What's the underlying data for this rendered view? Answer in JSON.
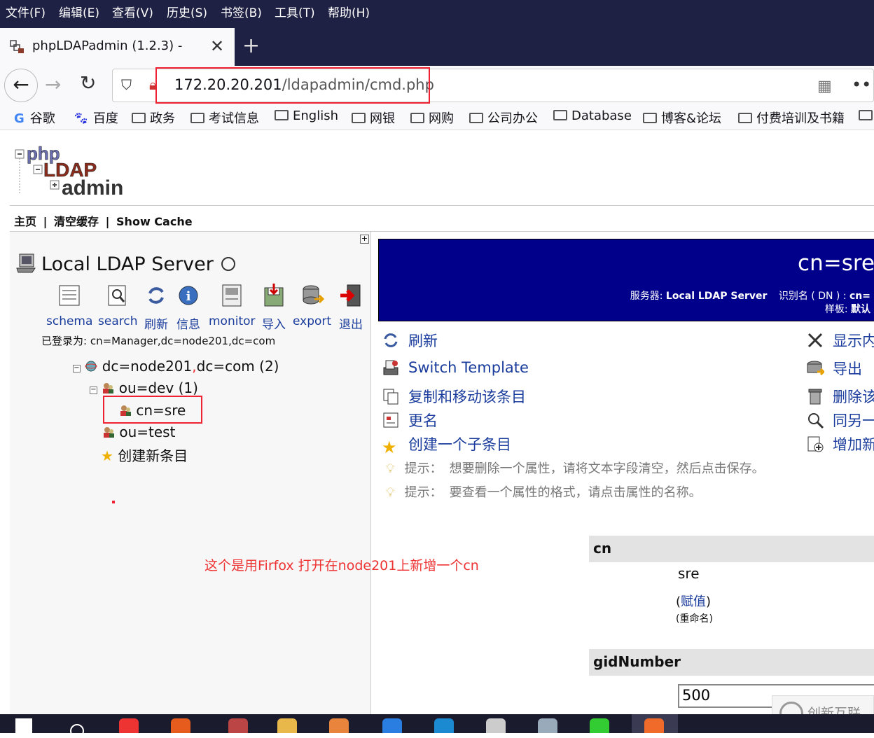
{
  "menubar": {
    "items": [
      "文件(F)",
      "编辑(E)",
      "查看(V)",
      "历史(S)",
      "书签(B)",
      "工具(T)",
      "帮助(H)"
    ]
  },
  "tab": {
    "title": "phpLDAPadmin (1.2.3) -"
  },
  "urlbar": {
    "host": "172.20.20.201",
    "path": "/ldapadmin/cmd.php"
  },
  "bookmarks": [
    "谷歌",
    "百度",
    "政务",
    "考试信息",
    "English",
    "网银",
    "网购",
    "公司办公",
    "Database",
    "博客&论坛",
    "付费培训及书籍"
  ],
  "toplinks": {
    "home": "主页",
    "clear": "清空缓存",
    "show": "Show Cache",
    "sep": "|"
  },
  "server": {
    "title": "Local LDAP Server",
    "tools": [
      "schema",
      "search",
      "刷新",
      "信息",
      "monitor",
      "导入",
      "export",
      "退出"
    ],
    "logged_in": "已登录为: cn=Manager,dc=node201,dc=com"
  },
  "tree": {
    "root": "dc=node201",
    "root_sep": ",",
    "root_rest": "dc=com (2)",
    "dev": "ou=dev (1)",
    "sre": "cn=sre",
    "test": "ou=test",
    "create": "创建新条目"
  },
  "annotation": "这个是用Firfox 打开在node201上新增一个cn",
  "entry": {
    "dn": "cn=sre",
    "server_label": "服务器:",
    "server_name": "Local LDAP Server",
    "dn_label": "识别名 ( DN ) :",
    "dn_value": "cn=",
    "template_label": "样板:",
    "template_value": "默认"
  },
  "actions_left": [
    "刷新",
    "Switch Template",
    "复制和移动该条目",
    "更名",
    "创建一个子条目"
  ],
  "actions_right": [
    "显示内",
    "导出",
    "删除该",
    "同另一",
    "增加新"
  ],
  "hints": {
    "label": "提示：",
    "hint1": "想要删除一个属性，请将文本字段清空，然后点击保存。",
    "hint2": "要查看一个属性的格式，请点击属性的名称。"
  },
  "attributes": {
    "cn_name": "cn",
    "cn_value": "sre",
    "assign": "赋值",
    "rename": "(重命名)",
    "gid_name": "gidNumber",
    "gid_value": "500"
  },
  "watermark": "创新互联",
  "colors": {
    "banner": "#00008b",
    "link": "#1a3c9c",
    "highlight": "#e23333",
    "browser_dark": "#1e2044"
  }
}
